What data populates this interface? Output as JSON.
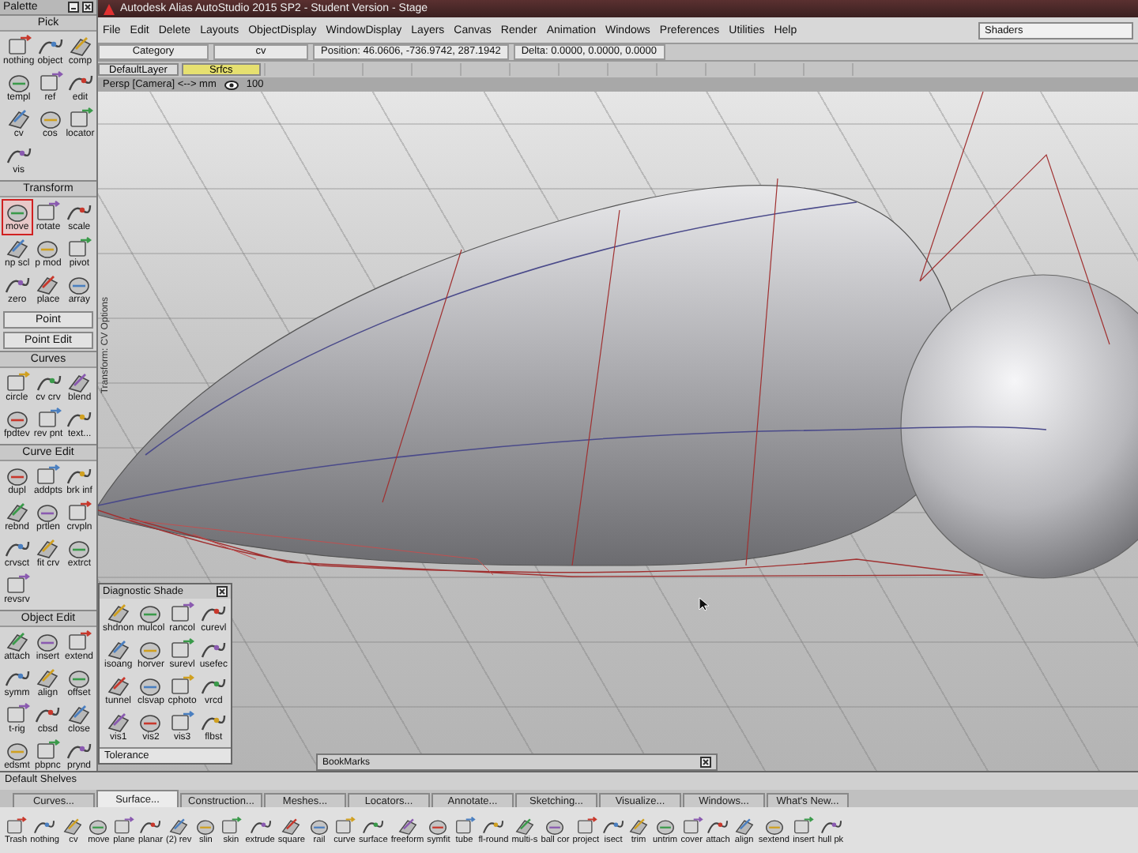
{
  "window": {
    "title": "Autodesk Alias AutoStudio 2015 SP2 - Student Version - Stage"
  },
  "menu": [
    "File",
    "Edit",
    "Delete",
    "Layouts",
    "ObjectDisplay",
    "WindowDisplay",
    "Layers",
    "Canvas",
    "Render",
    "Animation",
    "Windows",
    "Preferences",
    "Utilities",
    "Help"
  ],
  "shaders": "Shaders",
  "toolbar": {
    "category": "Category",
    "tool": "cv",
    "position": "Position: 46.0606, -736.9742, 287.1942",
    "delta": "Delta: 0.0000, 0.0000, 0.0000"
  },
  "layers": [
    {
      "label": "DefaultLayer",
      "selected": false
    },
    {
      "label": "Srfcs",
      "selected": true
    }
  ],
  "viewport": {
    "camera": "Persp [Camera]  <-->  mm",
    "zoom": "100",
    "side_label": "Transform: CV Options"
  },
  "palette": {
    "title": "Palette",
    "sections": [
      {
        "title": "Pick",
        "expanded": true,
        "tools": [
          {
            "label": "nothing",
            "selected": false
          },
          {
            "label": "object",
            "selected": false
          },
          {
            "label": "comp",
            "selected": false
          },
          {
            "label": "templ",
            "selected": false
          },
          {
            "label": "ref",
            "selected": false
          },
          {
            "label": "edit",
            "selected": false
          },
          {
            "label": "cv",
            "selected": false
          },
          {
            "label": "cos",
            "selected": false
          },
          {
            "label": "locator",
            "selected": false
          },
          {
            "label": "vis",
            "selected": false
          }
        ]
      },
      {
        "title": "Transform",
        "expanded": true,
        "tools": [
          {
            "label": "move",
            "selected": true
          },
          {
            "label": "rotate",
            "selected": false
          },
          {
            "label": "scale",
            "selected": false
          },
          {
            "label": "np scl",
            "selected": false
          },
          {
            "label": "p mod",
            "selected": false
          },
          {
            "label": "pivot",
            "selected": false
          },
          {
            "label": "zero",
            "selected": false
          },
          {
            "label": "place",
            "selected": false
          },
          {
            "label": "array",
            "selected": false
          }
        ]
      },
      {
        "title": "Point",
        "expanded": false
      },
      {
        "title": "Point Edit",
        "expanded": false
      },
      {
        "title": "Curves",
        "expanded": true,
        "tools": [
          {
            "label": "circle",
            "selected": false
          },
          {
            "label": "cv crv",
            "selected": false
          },
          {
            "label": "blend",
            "selected": false
          },
          {
            "label": "fpdtev",
            "selected": false
          },
          {
            "label": "rev pnt",
            "selected": false
          },
          {
            "label": "text...",
            "selected": false
          }
        ]
      },
      {
        "title": "Curve Edit",
        "expanded": true,
        "tools": [
          {
            "label": "dupl",
            "selected": false
          },
          {
            "label": "addpts",
            "selected": false
          },
          {
            "label": "brk inf",
            "selected": false
          },
          {
            "label": "rebnd",
            "selected": false
          },
          {
            "label": "prtlen",
            "selected": false
          },
          {
            "label": "crvpln",
            "selected": false
          },
          {
            "label": "crvsct",
            "selected": false
          },
          {
            "label": "fit crv",
            "selected": false
          },
          {
            "label": "extrct",
            "selected": false
          },
          {
            "label": "revsrv",
            "selected": false
          }
        ]
      },
      {
        "title": "Object Edit",
        "expanded": true,
        "tools": [
          {
            "label": "attach",
            "selected": false
          },
          {
            "label": "insert",
            "selected": false
          },
          {
            "label": "extend",
            "selected": false
          },
          {
            "label": "symm",
            "selected": false
          },
          {
            "label": "align",
            "selected": false
          },
          {
            "label": "offset",
            "selected": false
          },
          {
            "label": "t-rig",
            "selected": false
          },
          {
            "label": "cbsd",
            "selected": false
          },
          {
            "label": "close",
            "selected": false
          },
          {
            "label": "edsmt",
            "selected": false
          },
          {
            "label": "pbpnc",
            "selected": false
          },
          {
            "label": "prynd",
            "selected": false
          }
        ]
      }
    ]
  },
  "diagnostic_shade": {
    "title": "Diagnostic Shade",
    "tools": [
      "shdnon",
      "mulcol",
      "rancol",
      "curevl",
      "isoang",
      "horver",
      "surevl",
      "usefec",
      "tunnel",
      "clsvap",
      "cphoto",
      "vrcd",
      "vis1",
      "vis2",
      "vis3",
      "flbst"
    ],
    "tolerance": "Tolerance"
  },
  "bookmarks": "BookMarks",
  "shelves": {
    "title": "Default Shelves",
    "tabs": [
      {
        "label": "Curves...",
        "selected": false
      },
      {
        "label": "Surface...",
        "selected": true
      },
      {
        "label": "Construction...",
        "selected": false
      },
      {
        "label": "Meshes...",
        "selected": false
      },
      {
        "label": "Locators...",
        "selected": false
      },
      {
        "label": "Annotate...",
        "selected": false
      },
      {
        "label": "Sketching...",
        "selected": false
      },
      {
        "label": "Visualize...",
        "selected": false
      },
      {
        "label": "Windows...",
        "selected": false
      },
      {
        "label": "What's New...",
        "selected": false
      }
    ],
    "tools": [
      "Trash",
      "nothing",
      "cv",
      "move",
      "plane",
      "planar",
      "(2) rev",
      "slin",
      "skin",
      "extrude",
      "square",
      "rail",
      "curve",
      "surface",
      "freeform",
      "symfit",
      "tube",
      "fl-round",
      "multi-s",
      "ball cor",
      "project",
      "isect",
      "trim",
      "untrim",
      "cover",
      "attach",
      "align",
      "sextend",
      "insert",
      "hull pk"
    ]
  }
}
